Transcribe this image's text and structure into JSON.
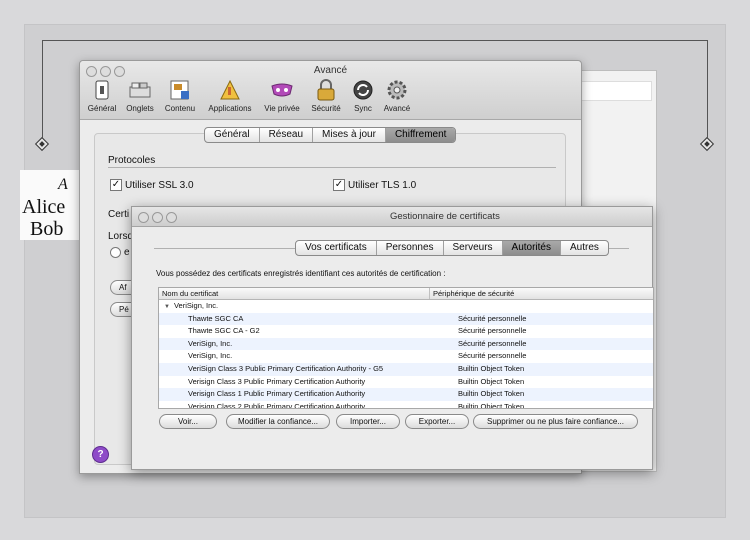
{
  "slide": {
    "line1": "Alice",
    "line2": "Bob",
    "handwriting": "A"
  },
  "prefs": {
    "title": "Avancé",
    "toolbar": [
      {
        "label": "Général",
        "icon": "general-icon"
      },
      {
        "label": "Onglets",
        "icon": "tabs-icon"
      },
      {
        "label": "Contenu",
        "icon": "content-icon"
      },
      {
        "label": "Applications",
        "icon": "applications-icon"
      },
      {
        "label": "Vie privée",
        "icon": "privacy-icon"
      },
      {
        "label": "Sécurité",
        "icon": "security-icon"
      },
      {
        "label": "Sync",
        "icon": "sync-icon"
      },
      {
        "label": "Avancé",
        "icon": "advanced-icon"
      }
    ],
    "tabs": [
      "Général",
      "Réseau",
      "Mises à jour",
      "Chiffrement"
    ],
    "active_tab": "Chiffrement",
    "protocols_title": "Protocoles",
    "ssl_label": "Utiliser SSL 3.0",
    "tls_label": "Utiliser TLS 1.0",
    "certs_section_partial": "Certi",
    "lorsq_partial": "Lorsq",
    "radio_partial": "e",
    "btn1_partial": "Af",
    "btn2_partial": "Pé",
    "help": "?"
  },
  "certmgr": {
    "title": "Gestionnaire de certificats",
    "tabs": [
      "Vos certificats",
      "Personnes",
      "Serveurs",
      "Autorités",
      "Autres"
    ],
    "active_tab": "Autorités",
    "description": "Vous possédez des certificats enregistrés identifiant ces autorités de certification :",
    "columns": [
      "Nom du certificat",
      "Périphérique de sécurité"
    ],
    "group": "VeriSign, Inc.",
    "rows": [
      {
        "name": "Thawte SGC CA",
        "device": "Sécurité personnelle"
      },
      {
        "name": "Thawte SGC CA - G2",
        "device": "Sécurité personnelle"
      },
      {
        "name": "VeriSign, Inc.",
        "device": "Sécurité personnelle"
      },
      {
        "name": "VeriSign, Inc.",
        "device": "Sécurité personnelle"
      },
      {
        "name": "VeriSign Class 3 Public Primary Certification Authority - G5",
        "device": "Builtin Object Token"
      },
      {
        "name": "Verisign Class 3 Public Primary Certification Authority",
        "device": "Builtin Object Token"
      },
      {
        "name": "Verisign Class 1 Public Primary Certification Authority",
        "device": "Builtin Object Token"
      },
      {
        "name": "Verisign Class 2 Public Primary Certification Authority",
        "device": "Builtin Object Token"
      }
    ],
    "buttons": {
      "view": "Voir...",
      "edit_trust": "Modifier la confiance...",
      "import": "Importer...",
      "export": "Exporter...",
      "delete": "Supprimer ou ne plus faire confiance..."
    }
  }
}
